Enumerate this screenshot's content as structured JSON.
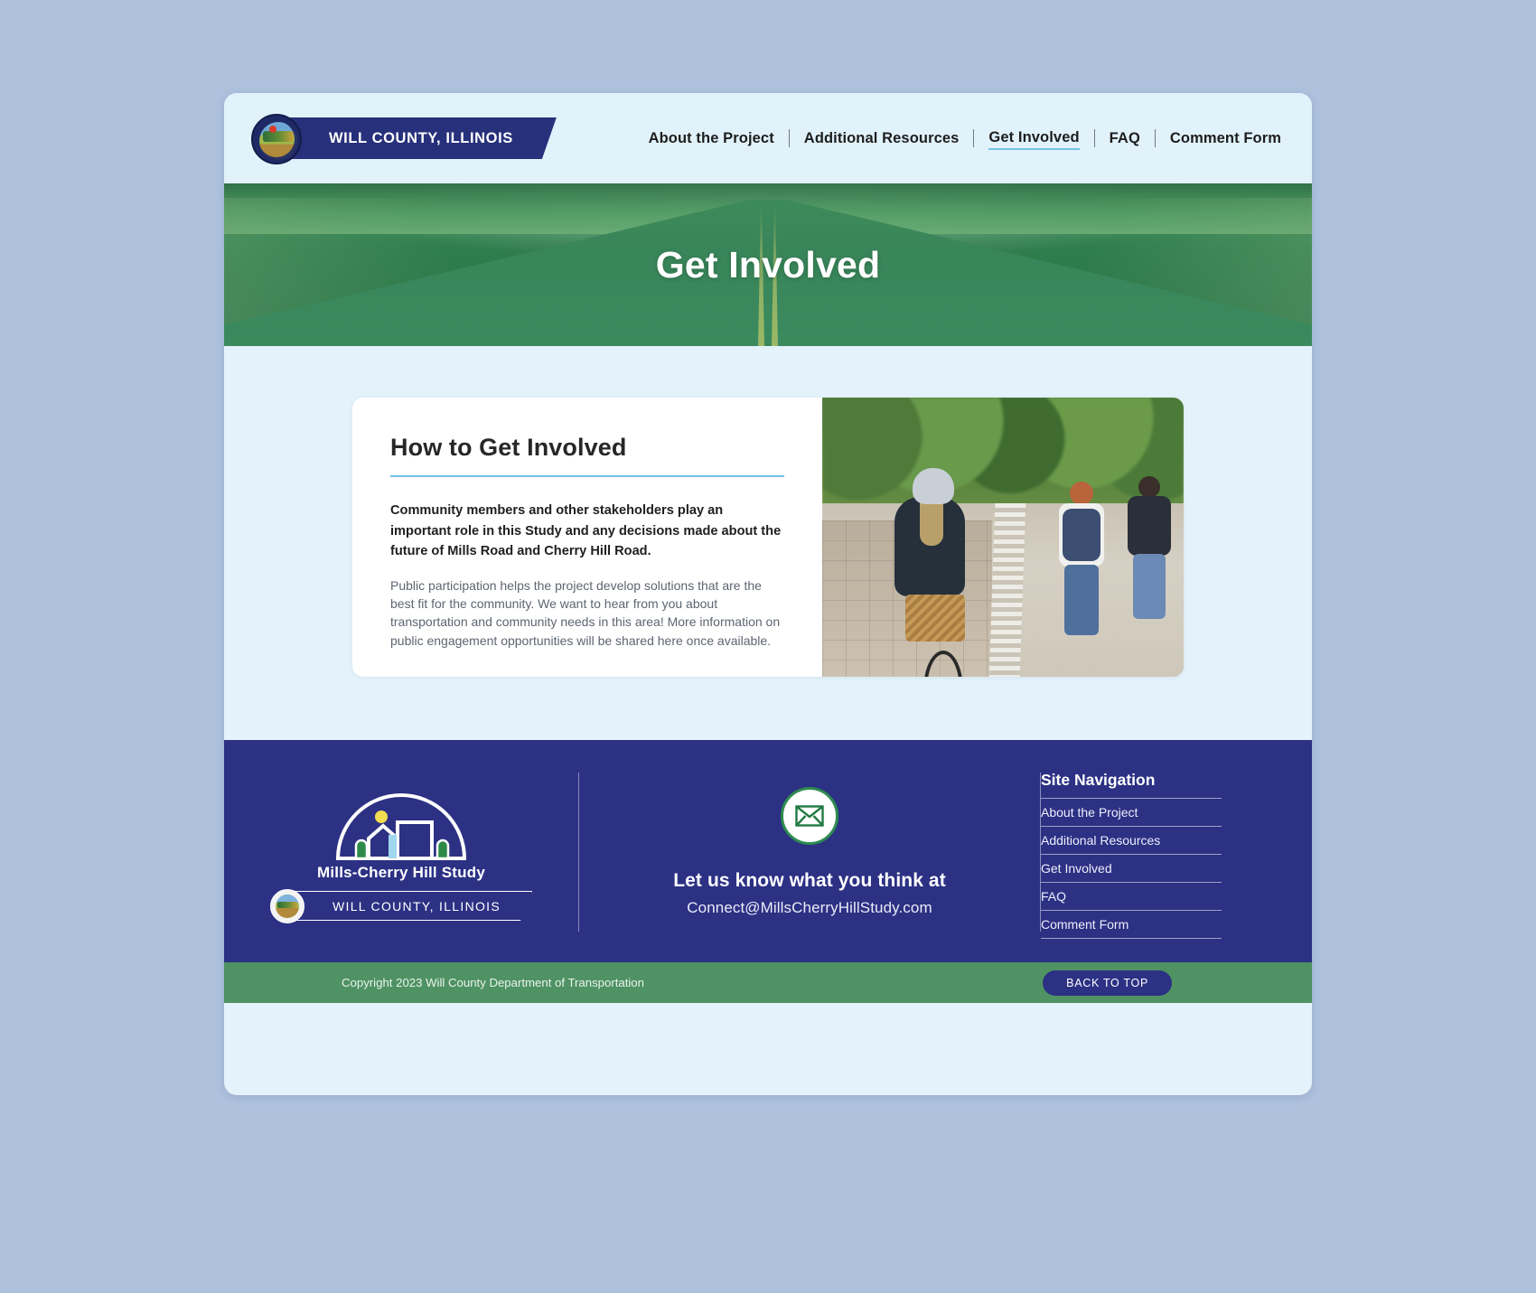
{
  "header": {
    "brand_name": "WILL COUNTY, ILLINOIS",
    "seal_icon": "will-county-seal-icon",
    "nav": [
      {
        "label": "About the Project",
        "active": false
      },
      {
        "label": "Additional Resources",
        "active": false
      },
      {
        "label": "Get Involved",
        "active": true
      },
      {
        "label": "FAQ",
        "active": false
      },
      {
        "label": "Comment Form",
        "active": false
      }
    ]
  },
  "hero": {
    "title": "Get Involved",
    "background_description": "green-tinted road photo banner"
  },
  "main": {
    "card": {
      "heading": "How to Get Involved",
      "lead": "Community members and other stakeholders play an important role in this Study and any decisions made about the future of Mills Road and Cherry Hill Road.",
      "body": "Public participation helps the project develop solutions that are the best fit for the community. We want to hear from you about transportation and community needs in this area! More information on public engagement opportunities will be shared here once available.",
      "photo_alt": "Cyclist and pedestrians on a tree-lined shared-use path"
    }
  },
  "footer": {
    "logo": {
      "icon": "mills-cherry-hill-arch-icon",
      "study_title": "Mills-Cherry Hill Study",
      "county_name": "WILL COUNTY, ILLINOIS",
      "seal_icon": "will-county-seal-icon"
    },
    "contact": {
      "icon": "envelope-icon",
      "headline": "Let us know what you think at",
      "email": "Connect@MillsCherryHillStudy.com"
    },
    "site_navigation": {
      "title": "Site Navigation",
      "items": [
        {
          "label": "About the Project"
        },
        {
          "label": "Additional Resources"
        },
        {
          "label": "Get Involved"
        },
        {
          "label": "FAQ"
        },
        {
          "label": "Comment Form"
        }
      ]
    }
  },
  "copyright_bar": {
    "text": "Copyright 2023 Will County Department of Transportation",
    "back_to_top_label": "BACK TO TOP"
  },
  "colors": {
    "page_bg": "#aec2de",
    "panel_bg": "#e4f3fb",
    "header_bg": "#e1f2fb",
    "navy": "#2c3184",
    "green": "#4f9263",
    "accent_blue": "#6fc0e4",
    "hero_green": "#2f7d4d"
  }
}
